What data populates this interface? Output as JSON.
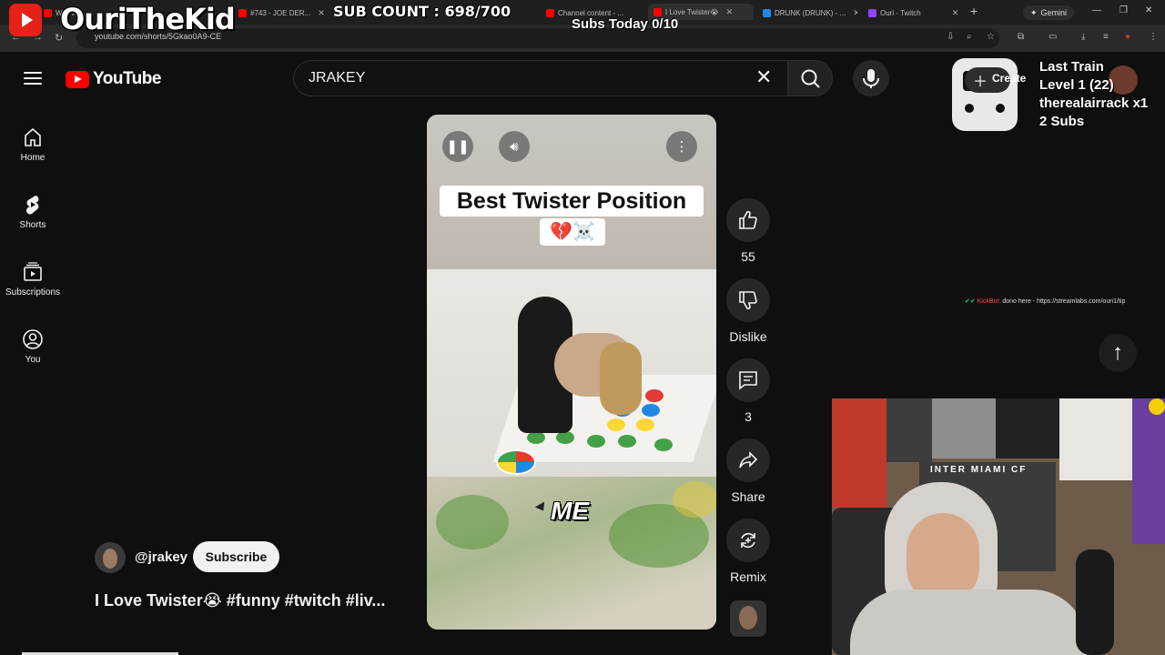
{
  "browser": {
    "tabs": [
      {
        "label": "We Are...",
        "favicon_color": "#ff0000"
      },
      {
        "label": "...",
        "favicon_color": "#888888"
      },
      {
        "label": "#743 - JOE DER...",
        "favicon_color": "#ff0000"
      },
      {
        "label": "...",
        "favicon_color": "#2ecc71"
      },
      {
        "label": "Channel content - ...",
        "favicon_color": "#ff0000"
      },
      {
        "label": "I Love Twister😭",
        "favicon_color": "#ff0000"
      },
      {
        "label": "DRUNK (DRUNK) - ...",
        "favicon_color": "#1e88e5"
      },
      {
        "label": "Ouri - Twitch",
        "favicon_color": "#9146ff"
      }
    ],
    "gemini_label": "Gemini",
    "url": "youtube.com/shorts/5Gkao0A9-CE"
  },
  "overlay": {
    "streamer_name": "OuriTheKid",
    "sub_count": "SUB COUNT : 698/700",
    "subs_today": "Subs Today 0/10",
    "create_label": "Create",
    "last_train_line1": "Last Train",
    "last_train_line2": "Level 1  (22)",
    "last_train_line3": "therealairrack x1",
    "last_train_line4": "2 Subs",
    "ticker_user": "KickBot:",
    "ticker_text": "dono here - https://streamlabs.com/ouri1/tip",
    "cam_banner": "INTER MIAMI CF"
  },
  "header": {
    "logo_text": "YouTube",
    "search_value": "JRAKEY"
  },
  "sidebar": {
    "items": [
      {
        "label": "Home",
        "icon": "home-icon"
      },
      {
        "label": "Shorts",
        "icon": "shorts-icon"
      },
      {
        "label": "Subscriptions",
        "icon": "subscriptions-icon"
      },
      {
        "label": "You",
        "icon": "you-icon"
      }
    ]
  },
  "short": {
    "caption_text": "Best Twister Position",
    "caption_emoji": "💔☠️",
    "overlay_word": "ME",
    "channel_handle": "@jrakey",
    "subscribe_label": "Subscribe",
    "title": "I Love Twister😭 #funny #twitch #liv..."
  },
  "actions": {
    "like_count": "55",
    "dislike_label": "Dislike",
    "comment_count": "3",
    "share_label": "Share",
    "remix_label": "Remix"
  },
  "colors": {
    "yt_red": "#ff0000",
    "bg": "#0f0f0f",
    "button_bg": "#272727"
  }
}
